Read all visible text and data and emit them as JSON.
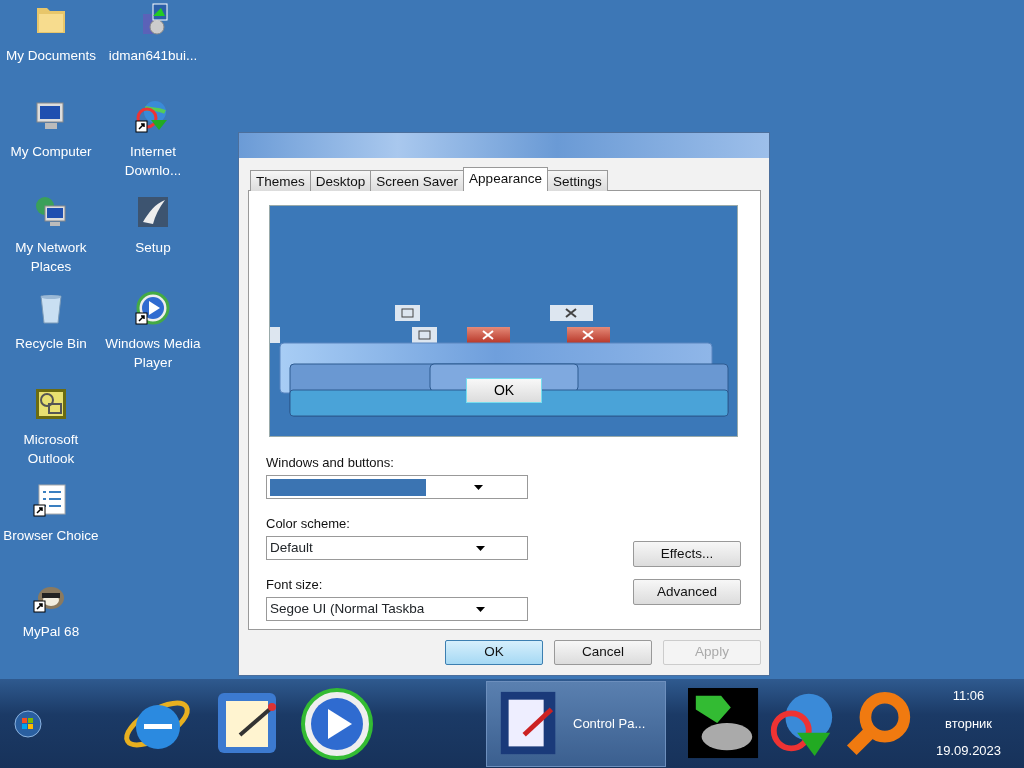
{
  "desktop": {
    "columns": [
      {
        "icons": [
          {
            "label": "My Documents",
            "kind": "folder",
            "shortcut": false
          },
          {
            "label": "My Computer",
            "kind": "computer",
            "shortcut": false
          },
          {
            "label": "My Network Places",
            "kind": "network",
            "shortcut": false
          },
          {
            "label": "Recycle Bin",
            "kind": "bin",
            "shortcut": false
          },
          {
            "label": "Microsoft Outlook",
            "kind": "outlook",
            "shortcut": false
          },
          {
            "label": "Browser Choice",
            "kind": "checklist",
            "shortcut": true
          },
          {
            "label": "MyPal 68",
            "kind": "raccoon",
            "shortcut": true
          }
        ]
      },
      {
        "icons": [
          {
            "label": "idman641bui...",
            "kind": "installer",
            "shortcut": false
          },
          {
            "label": "Internet Downlo...",
            "kind": "globe",
            "shortcut": true
          },
          {
            "label": "Setup",
            "kind": "setup",
            "shortcut": false
          },
          {
            "label": "Windows Media Player",
            "kind": "media",
            "shortcut": true
          }
        ]
      }
    ]
  },
  "dialog": {
    "tabs": [
      {
        "label": "Themes",
        "selected": false
      },
      {
        "label": "Desktop",
        "selected": false
      },
      {
        "label": "Screen Saver",
        "selected": false
      },
      {
        "label": "Appearance",
        "selected": true
      },
      {
        "label": "Settings",
        "selected": false
      }
    ],
    "preview": {
      "button": "OK"
    },
    "fields": [
      {
        "label": "Windows and buttons:",
        "kind": "swatch"
      },
      {
        "label": "Color scheme:",
        "kind": "text",
        "value": "Default"
      },
      {
        "label": "Font size:",
        "kind": "text",
        "value": "Segoe UI (Normal Taskba"
      }
    ],
    "side_buttons": [
      "Effects...",
      "Advanced"
    ],
    "buttons": [
      {
        "label": "OK",
        "disabled": false,
        "focused": true
      },
      {
        "label": "Cancel",
        "disabled": false,
        "focused": false
      },
      {
        "label": "Apply",
        "disabled": true,
        "focused": false
      }
    ]
  },
  "taskbar": {
    "pinned": [
      {
        "kind": "browser"
      },
      {
        "kind": "notepad"
      },
      {
        "kind": "media"
      }
    ],
    "tasks": [
      {
        "label": "Control Pa...",
        "selected": true
      }
    ],
    "tray": [
      {
        "kind": "green"
      },
      {
        "kind": "globe"
      },
      {
        "kind": "magnifier"
      }
    ],
    "clock": {
      "time": "11:06",
      "day": "вторник",
      "date": "19.09.2023"
    }
  }
}
